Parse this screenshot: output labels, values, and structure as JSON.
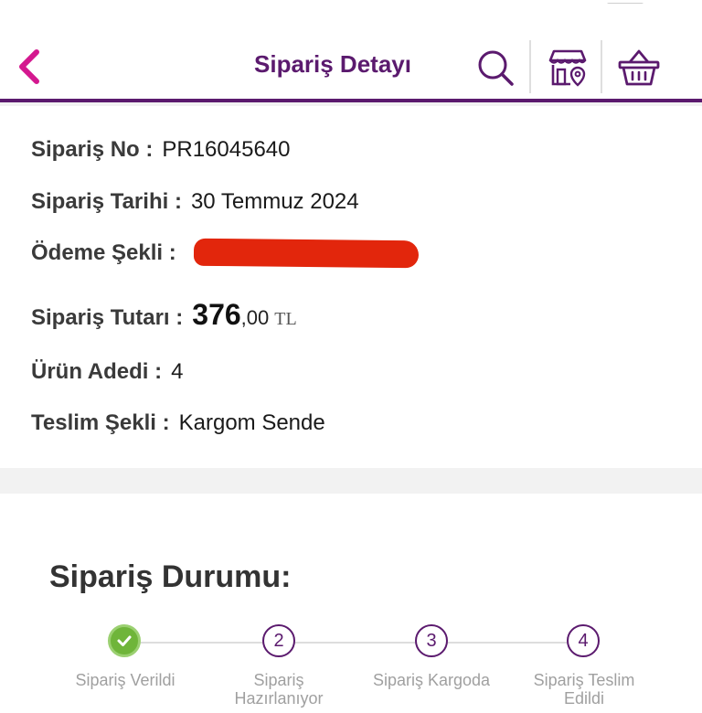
{
  "header": {
    "title": "Sipariş Detayı",
    "icons": {
      "back": "chevron-left-icon",
      "search": "search-icon",
      "store": "store-location-icon",
      "basket": "basket-icon"
    }
  },
  "order": {
    "number_label": "Sipariş No :",
    "number": "PR16045640",
    "date_label": "Sipariş Tarihi :",
    "date": "30 Temmuz 2024",
    "payment_label": "Ödeme Şekli :",
    "amount_label": "Sipariş Tutarı :",
    "amount_main": "376",
    "amount_decimal": ",00",
    "amount_currency": "TL",
    "quantity_label": "Ürün Adedi :",
    "quantity": "4",
    "delivery_label": "Teslim Şekli :",
    "delivery": "Kargom Sende"
  },
  "status": {
    "title": "Sipariş Durumu:",
    "steps": [
      {
        "number": "",
        "label": "Sipariş Verildi",
        "state": "done"
      },
      {
        "number": "2",
        "label": "Sipariş Hazırlanıyor",
        "state": "pending"
      },
      {
        "number": "3",
        "label": "Sipariş Kargoda",
        "state": "pending"
      },
      {
        "number": "4",
        "label": "Sipariş Teslim Edildi",
        "state": "pending"
      }
    ]
  },
  "colors": {
    "brand": "#5b1a6e",
    "back_accent": "#d4188f",
    "done": "#6fb53a",
    "redaction": "#e2260c"
  }
}
